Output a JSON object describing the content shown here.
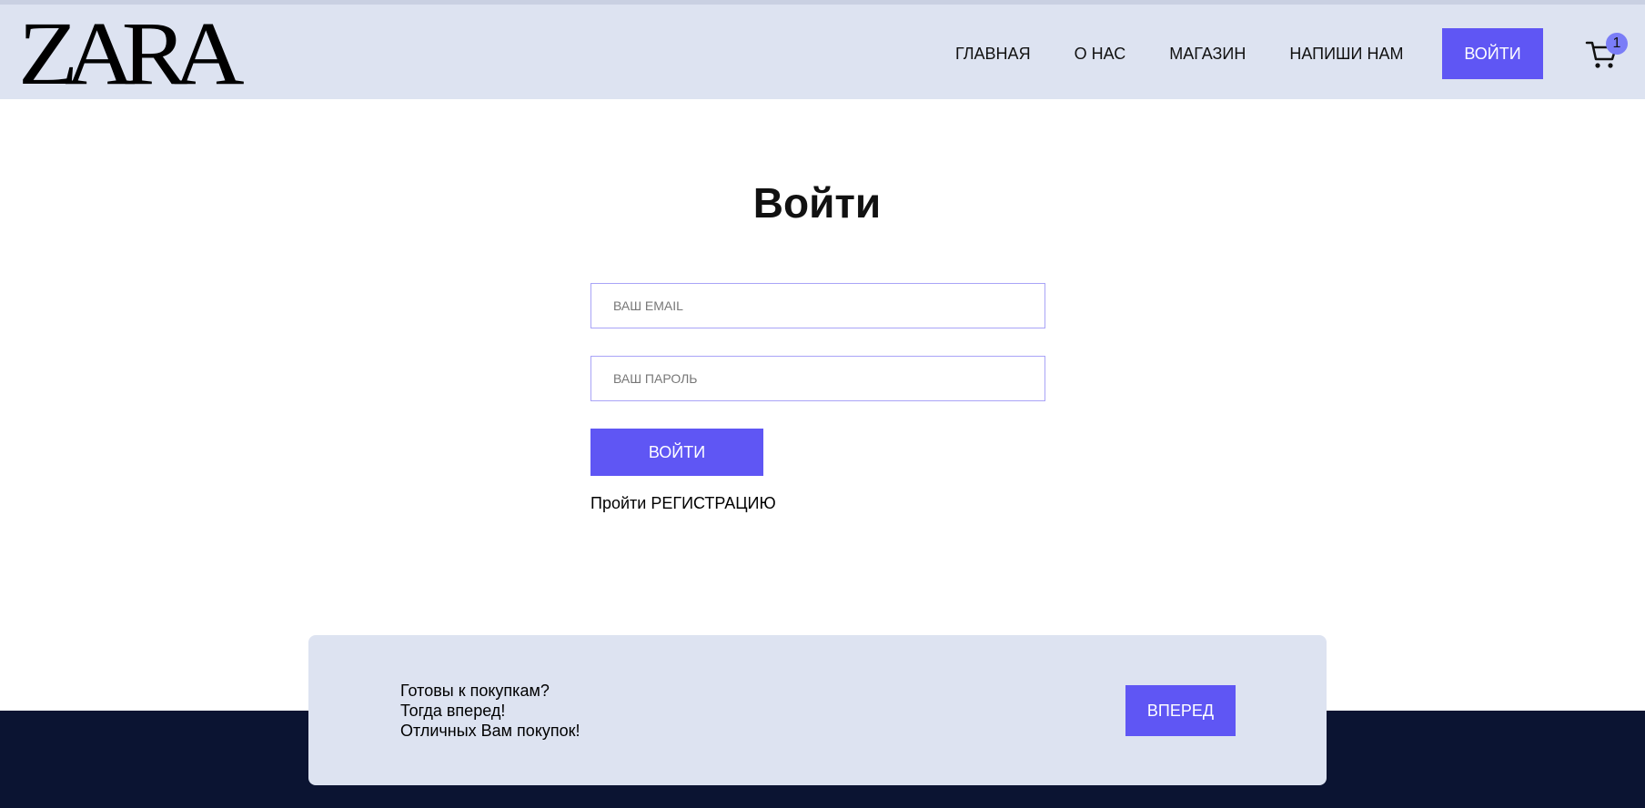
{
  "header": {
    "logo": "ZARA",
    "nav": [
      "ГЛАВНАЯ",
      "О НАС",
      "МАГАЗИН",
      "НАПИШИ НАМ"
    ],
    "login_label": "ВОЙТИ",
    "cart_count": "1"
  },
  "login": {
    "title": "Войти",
    "email_placeholder": "ВАШ EMAIL",
    "password_placeholder": "ВАШ ПАРОЛЬ",
    "submit_label": "ВОЙТИ",
    "register_prefix": "Пройти",
    "register_link": "РЕГИСТРАЦИЮ"
  },
  "cta": {
    "lines": [
      "Готовы к покупкам?",
      "Тогда вперед!",
      "Отличных Вам покупок!"
    ],
    "button_label": "ВПЕРЕД"
  },
  "colors": {
    "accent": "#5f56f4",
    "header_bg": "#dde3f1",
    "footer_bg": "#0b1432"
  }
}
